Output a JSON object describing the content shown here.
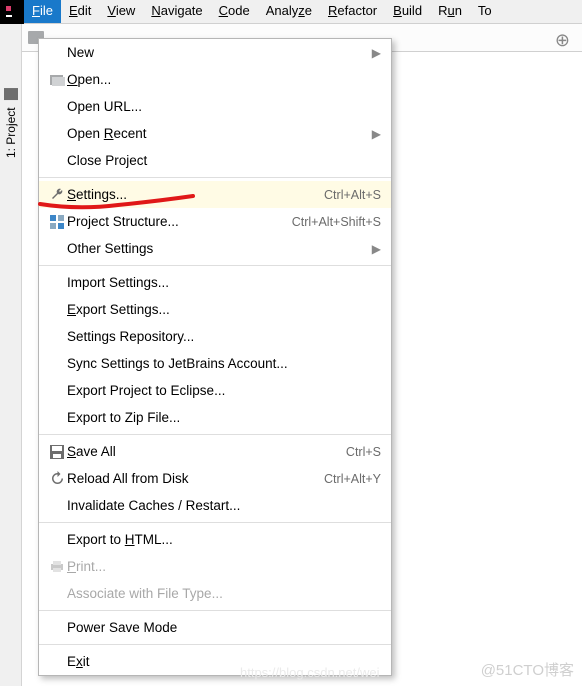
{
  "app": {
    "icon_color": "#db3d6c"
  },
  "menu": {
    "file": "File",
    "edit": "Edit",
    "view": "View",
    "navigate": "Navigate",
    "code": "Code",
    "analyze": "Analyze",
    "refactor": "Refactor",
    "build": "Build",
    "run": "Run",
    "tools": "To"
  },
  "sidebar": {
    "project_tab": "1: Project"
  },
  "dropdown": {
    "new": "New",
    "open": "Open...",
    "open_url": "Open URL...",
    "open_recent": "Open Recent",
    "close_project": "Close Project",
    "settings": "Settings...",
    "settings_shortcut": "Ctrl+Alt+S",
    "project_structure": "Project Structure...",
    "project_structure_shortcut": "Ctrl+Alt+Shift+S",
    "other_settings": "Other Settings",
    "import_settings": "Import Settings...",
    "export_settings": "Export Settings...",
    "settings_repo": "Settings Repository...",
    "sync_jetbrains": "Sync Settings to JetBrains Account...",
    "export_eclipse": "Export Project to Eclipse...",
    "export_zip": "Export to Zip File...",
    "save_all": "Save All",
    "save_all_shortcut": "Ctrl+S",
    "reload_disk": "Reload All from Disk",
    "reload_disk_shortcut": "Ctrl+Alt+Y",
    "invalidate": "Invalidate Caches / Restart...",
    "export_html": "Export to HTML...",
    "print": "Print...",
    "associate": "Associate with File Type...",
    "power_save": "Power Save Mode",
    "exit": "Exit"
  },
  "watermark": "@51CTO博客",
  "watermark2": "https://blog.csdn.net/wei"
}
